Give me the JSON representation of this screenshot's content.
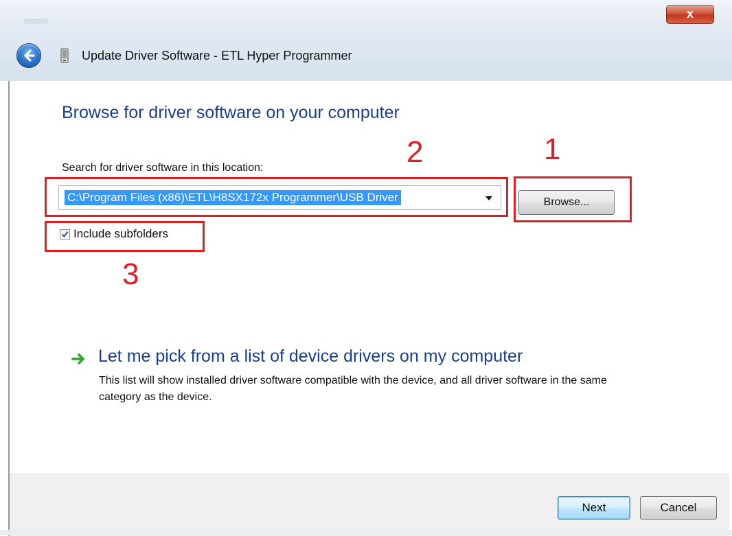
{
  "window": {
    "title": "Update Driver Software - ETL Hyper Programmer",
    "close_label": "x"
  },
  "main": {
    "heading": "Browse for driver software on your computer",
    "search_label": "Search for driver software in this location:",
    "path_value": "C:\\Program Files (x86)\\ETL\\H8SX172x Programmer\\USB Driver",
    "browse_label": "Browse...",
    "include_subfolders_label": "Include subfolders",
    "include_subfolders_checked": true
  },
  "annotations": {
    "browse_number": "1",
    "path_number": "2",
    "checkbox_number": "3",
    "color": "#e11d22"
  },
  "pick": {
    "title": "Let me pick from a list of device drivers on my computer",
    "description": "This list will show installed driver software compatible with the device, and all driver software in the same category as the device."
  },
  "footer": {
    "next_label": "Next",
    "cancel_label": "Cancel"
  },
  "icons": {
    "back": "back-arrow-icon",
    "device": "usb-device-icon",
    "pick_arrow": "green-arrow-icon",
    "check": "checkmark-icon"
  }
}
